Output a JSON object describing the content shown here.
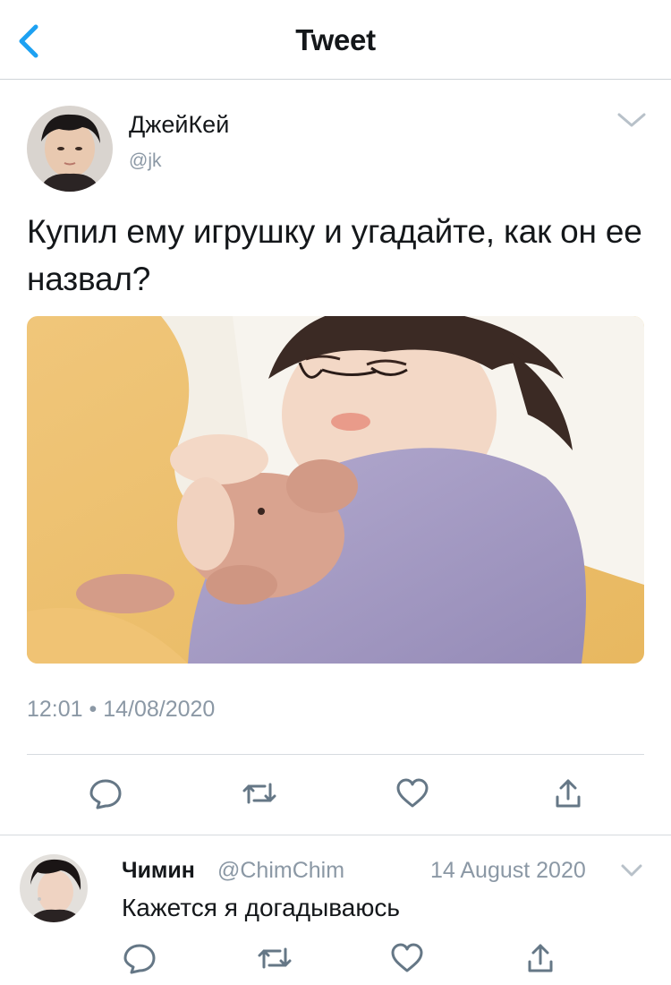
{
  "header": {
    "title": "Tweet",
    "back_icon": "chevron-left-icon",
    "accent": "#1da1f2"
  },
  "tweet": {
    "display_name": "ДжейКей",
    "handle": "@jk",
    "text": "Купил ему игрушку и угадайте, как он ее назвал?",
    "photo": "sleeping-child-with-plush-bunny",
    "timestamp": "12:01 • 14/08/2020",
    "actions": [
      "reply-icon",
      "retweet-icon",
      "like-icon",
      "share-icon"
    ]
  },
  "reply": {
    "display_name": "Чимин",
    "handle": "@ChimChim",
    "date": "14 August 2020",
    "text": "Кажется я догадываюсь",
    "actions": [
      "reply-icon",
      "retweet-icon",
      "like-icon",
      "share-icon"
    ]
  },
  "colors": {
    "text": "#14171a",
    "secondary": "#8b98a5",
    "divider": "#d6dbdf",
    "icon": "#657786"
  }
}
